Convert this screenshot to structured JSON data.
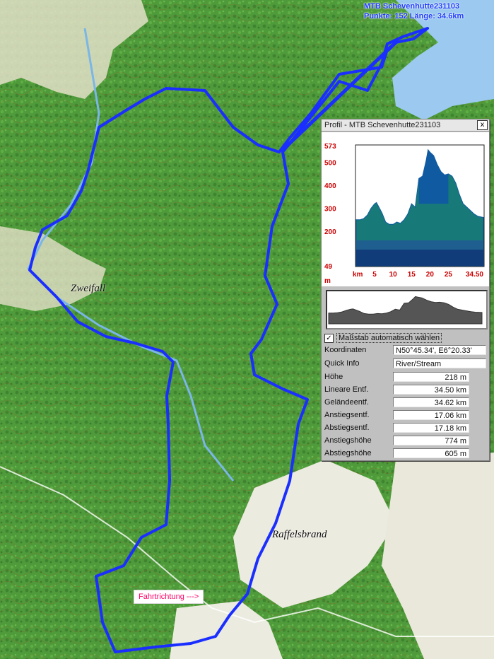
{
  "map": {
    "route_title": "MTB Schevenhutte231103",
    "route_stats": "Punkte: 152 Länge: 34.6km",
    "direction_label": "Fahrtrichtung --->",
    "places": [
      "Zweifall",
      "Raffelsbrand"
    ],
    "colors": {
      "route": "#1a2fff",
      "forest": "#4f9a3a",
      "field": "#e9eadc",
      "water": "#9bc9ef"
    }
  },
  "profile_window": {
    "title": "Profil - MTB Schevenhutte231103",
    "close_label": "x",
    "scale_checked": "✓",
    "scale_label": "Maßstab automatisch wählen",
    "info": [
      {
        "label": "Koordinaten",
        "value": "N50°45.34', E6°20.33'"
      },
      {
        "label": "Quick Info",
        "value": "River/Stream"
      },
      {
        "label": "Höhe",
        "value": "218 m"
      },
      {
        "label": "Lineare Entf.",
        "value": "34.50 km"
      },
      {
        "label": "Geländeentf.",
        "value": "34.62 km"
      },
      {
        "label": "Anstiegsentf.",
        "value": "17.06 km"
      },
      {
        "label": "Abstiegsentf.",
        "value": "17.18 km"
      },
      {
        "label": "Anstiegshöhe",
        "value": "774 m"
      },
      {
        "label": "Abstiegshöhe",
        "value": "605 m"
      }
    ]
  },
  "chart_data": {
    "type": "area",
    "title": "",
    "xlabel": "km",
    "ylabel": "m",
    "x_ticks": [
      "5",
      "10",
      "15",
      "20",
      "25",
      "34.50"
    ],
    "y_ticks": [
      "49",
      "200",
      "300",
      "400",
      "500",
      "573"
    ],
    "xlim": [
      0,
      34.5
    ],
    "ylim": [
      49,
      573
    ],
    "grid": false,
    "x": [
      0,
      1,
      2,
      3,
      4,
      5,
      5.5,
      6,
      7,
      8,
      9,
      10,
      11,
      12,
      13,
      14,
      15,
      16,
      17,
      18,
      19,
      19.5,
      20,
      21,
      22,
      23,
      24,
      25,
      26,
      27,
      28,
      29,
      30,
      31,
      32,
      33,
      34.5
    ],
    "values": [
      250,
      250,
      255,
      270,
      300,
      320,
      325,
      310,
      280,
      240,
      230,
      230,
      240,
      235,
      250,
      275,
      320,
      305,
      430,
      440,
      510,
      555,
      545,
      530,
      490,
      460,
      445,
      450,
      440,
      410,
      360,
      320,
      305,
      290,
      275,
      265,
      260
    ],
    "colors": {
      "bands": [
        "#103c7a",
        "#1f5f8f",
        "#177a78",
        "#0b6b78"
      ],
      "peak": "#0f5aa0",
      "axis_labels": "#cc0000"
    }
  }
}
